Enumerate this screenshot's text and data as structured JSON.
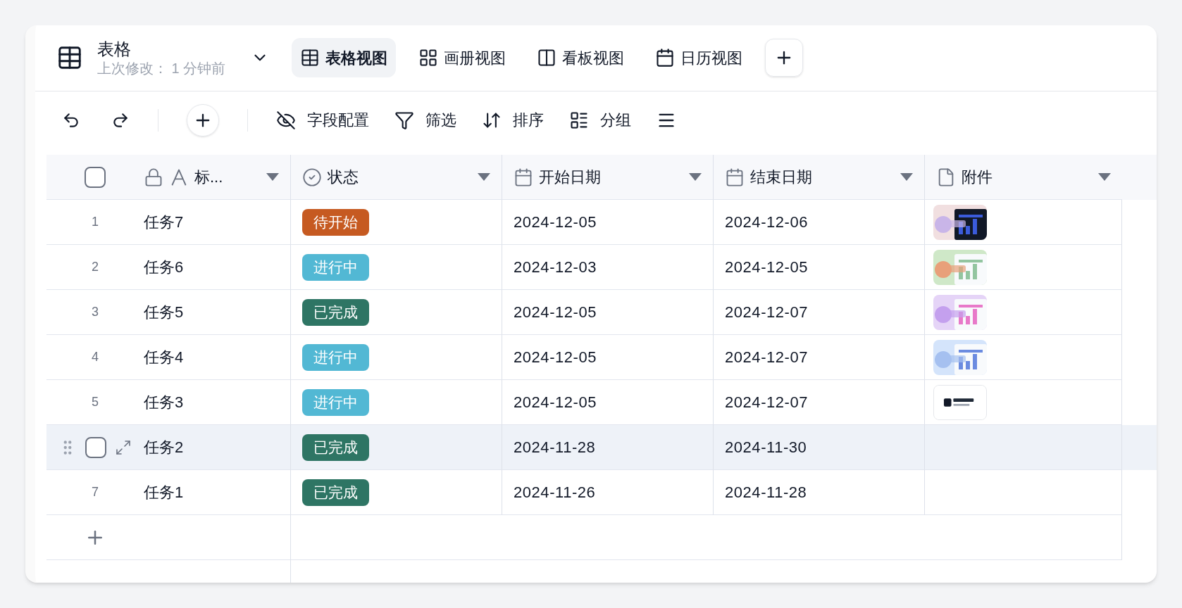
{
  "view": {
    "title": "表格",
    "subtitle": "上次修改： 1 分钟前"
  },
  "view_tabs": [
    {
      "label": "表格视图",
      "kind": "grid",
      "selected": true
    },
    {
      "label": "画册视图",
      "kind": "gallery",
      "selected": false
    },
    {
      "label": "看板视图",
      "kind": "kanban",
      "selected": false
    },
    {
      "label": "日历视图",
      "kind": "calendar",
      "selected": false
    }
  ],
  "toolbar": [
    {
      "label": "字段配置",
      "kind": "hide"
    },
    {
      "label": "筛选",
      "kind": "filter"
    },
    {
      "label": "排序",
      "kind": "sort"
    },
    {
      "label": "分组",
      "kind": "group"
    }
  ],
  "select_all": {
    "checked": false
  },
  "columns": [
    {
      "label": "标...",
      "kind": "text",
      "locked": true
    },
    {
      "label": "状态",
      "kind": "status",
      "locked": false
    },
    {
      "label": "开始日期",
      "kind": "date",
      "locked": false
    },
    {
      "label": "结束日期",
      "kind": "date",
      "locked": false
    },
    {
      "label": "附件",
      "kind": "attachment",
      "locked": false
    }
  ],
  "rows": [
    {
      "number": "1",
      "hovered": false,
      "checked": false,
      "title": "任务7",
      "status": {
        "label": "待开始",
        "color": "#c65a21"
      },
      "start": "2024-12-05",
      "end": "2024-12-06"
    },
    {
      "number": "2",
      "hovered": false,
      "checked": false,
      "title": "任务6",
      "status": {
        "label": "进行中",
        "color": "#52b8d4"
      },
      "start": "2024-12-03",
      "end": "2024-12-05"
    },
    {
      "number": "3",
      "hovered": false,
      "checked": false,
      "title": "任务5",
      "status": {
        "label": "已完成",
        "color": "#2e7564"
      },
      "start": "2024-12-05",
      "end": "2024-12-07"
    },
    {
      "number": "4",
      "hovered": false,
      "checked": false,
      "title": "任务4",
      "status": {
        "label": "进行中",
        "color": "#52b8d4"
      },
      "start": "2024-12-05",
      "end": "2024-12-07"
    },
    {
      "number": "5",
      "hovered": false,
      "checked": false,
      "title": "任务3",
      "status": {
        "label": "进行中",
        "color": "#52b8d4"
      },
      "start": "2024-12-05",
      "end": "2024-12-07"
    },
    {
      "hovered": true,
      "checked": false,
      "title": "任务2",
      "status": {
        "label": "已完成",
        "color": "#2e7564"
      },
      "start": "2024-11-28",
      "end": "2024-11-30"
    },
    {
      "number": "7",
      "hovered": false,
      "checked": false,
      "title": "任务1",
      "status": {
        "label": "已完成",
        "color": "#2e7564"
      },
      "start": "2024-11-26",
      "end": "2024-11-28"
    }
  ]
}
